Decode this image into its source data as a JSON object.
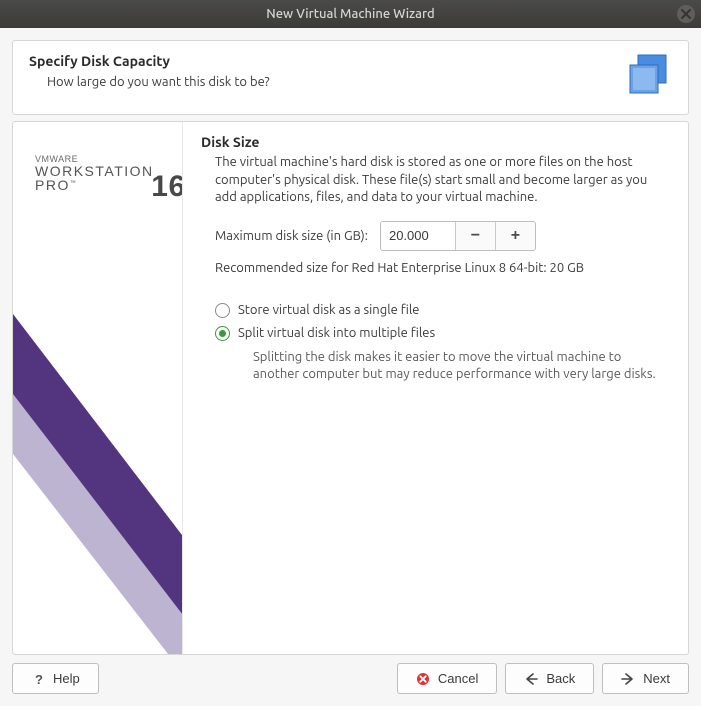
{
  "window_title": "New Virtual Machine Wizard",
  "header": {
    "title": "Specify Disk Capacity",
    "subtitle": "How large do you want this disk to be?"
  },
  "brand": {
    "line1": "VMWARE",
    "line2": "WORKSTATION",
    "line3": "PRO",
    "version": "16"
  },
  "content": {
    "heading": "Disk Size",
    "description": "The virtual machine's hard disk is stored as one or more files on the host computer's physical disk. These file(s) start small and become larger as you add applications, files, and data to your virtual machine.",
    "max_label": "Maximum disk size (in GB):",
    "max_value": "20.000",
    "recommended": "Recommended size for Red Hat Enterprise Linux 8 64-bit: 20 GB",
    "radios": {
      "single": "Store virtual disk as a single file",
      "split": "Split virtual disk into multiple files",
      "split_hint": "Splitting the disk makes it easier to move the virtual machine to another computer but may reduce performance with very large disks.",
      "selected": "split"
    }
  },
  "buttons": {
    "help": "Help",
    "cancel": "Cancel",
    "back": "Back",
    "next": "Next"
  }
}
